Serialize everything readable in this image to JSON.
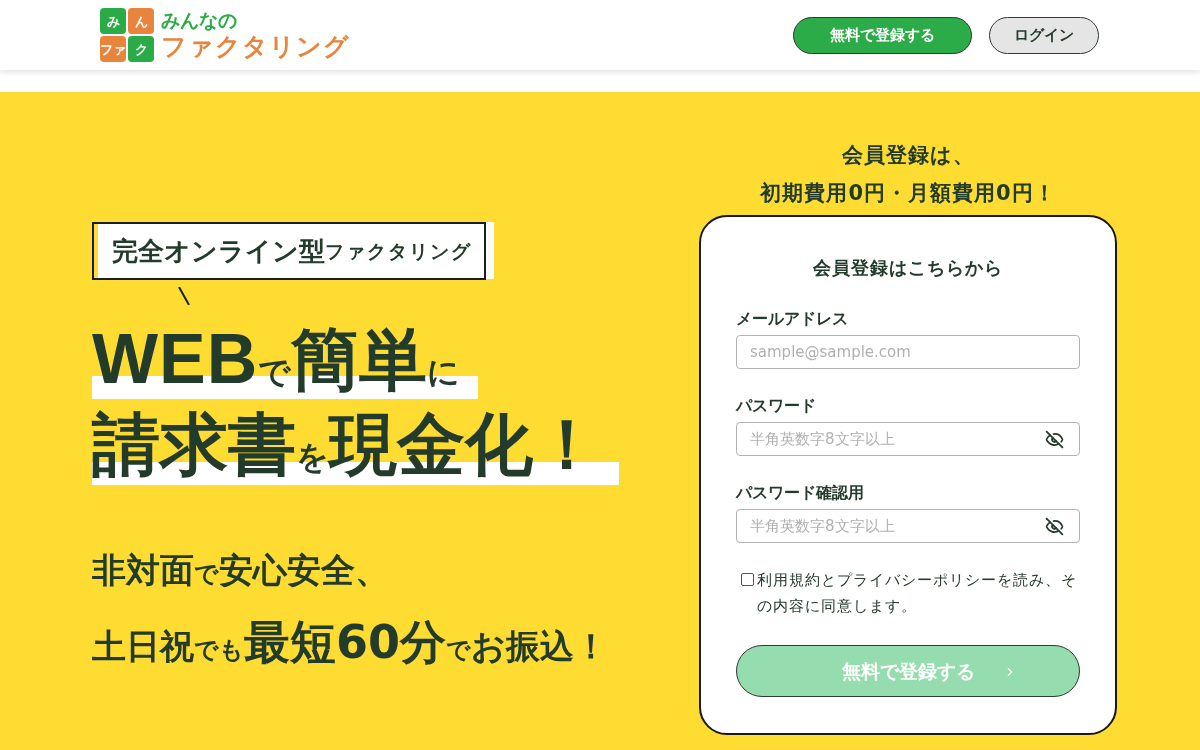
{
  "header": {
    "logo": {
      "tiles": [
        {
          "text": "み",
          "color": "#2bab47"
        },
        {
          "text": "ん",
          "color": "#e8843c"
        },
        {
          "text": "ファ",
          "color": "#e8843c"
        },
        {
          "text": "ク",
          "color": "#2bab47"
        }
      ],
      "top_line": "みんなの",
      "bottom_line": "ファクタリング"
    },
    "buttons": [
      {
        "label": "無料で登録する",
        "kind": "primary"
      },
      {
        "label": "ログイン",
        "kind": "secondary"
      }
    ]
  },
  "hero": {
    "badge": [
      {
        "text": "完全オンライン型",
        "kind": "large"
      },
      {
        "text": "ファクタリング",
        "kind": "small"
      }
    ],
    "headline_lines": [
      [
        {
          "text": "WEB",
          "kind": "latin"
        },
        {
          "text": "で",
          "kind": "small"
        },
        {
          "text": "簡単",
          "kind": "large"
        },
        {
          "text": "に",
          "kind": "small"
        }
      ],
      [
        {
          "text": "請求書",
          "kind": "large"
        },
        {
          "text": "を",
          "kind": "small"
        },
        {
          "text": "現金化！",
          "kind": "large"
        }
      ]
    ],
    "tagline_lines": [
      [
        {
          "text": "非対面",
          "kind": "medium"
        },
        {
          "text": "で",
          "kind": "small"
        },
        {
          "text": "安心安全、",
          "kind": "medium"
        }
      ],
      [
        {
          "text": "土日祝",
          "kind": "medium"
        },
        {
          "text": "でも",
          "kind": "small"
        },
        {
          "text": "最短60分",
          "kind": "large"
        },
        {
          "text": "で",
          "kind": "small"
        },
        {
          "text": "お振込！",
          "kind": "medium"
        }
      ]
    ]
  },
  "signup": {
    "intro_lines": [
      "会員登録は、",
      "初期費用0円・月額費用0円！"
    ],
    "title": "会員登録はこちらから",
    "fields": [
      {
        "label": "メールアドレス",
        "placeholder": "sample@sample.com",
        "kind": "email"
      },
      {
        "label": "パスワード",
        "placeholder": "半角英数字8文字以上",
        "kind": "password"
      },
      {
        "label": "パスワード確認用",
        "placeholder": "半角英数字8文字以上",
        "kind": "password"
      }
    ],
    "agreement": {
      "text": "利用規約とプライバシーポリシーを読み、その内容に同意します。",
      "checked": false
    },
    "submit": {
      "label": "無料で登録する",
      "disabled": true
    }
  }
}
